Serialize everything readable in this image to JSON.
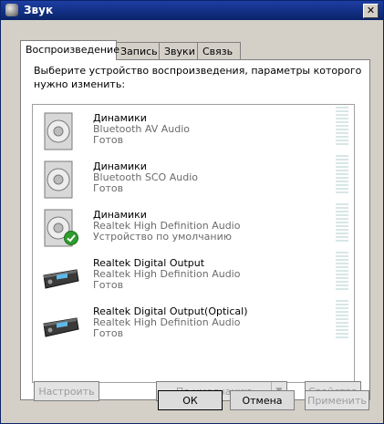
{
  "window": {
    "title": "Звук",
    "close_glyph": "✕"
  },
  "tabs": [
    {
      "label": "Воспроизведение",
      "active": true
    },
    {
      "label": "Запись",
      "active": false
    },
    {
      "label": "Звуки",
      "active": false
    },
    {
      "label": "Связь",
      "active": false
    }
  ],
  "instructions": "Выберите устройство воспроизведения, параметры которого нужно изменить:",
  "devices": [
    {
      "name": "Динамики",
      "desc": "Bluetooth AV Audio",
      "status": "Готов",
      "icon": "speaker-icon",
      "default": false
    },
    {
      "name": "Динамики",
      "desc": "Bluetooth SCO Audio",
      "status": "Готов",
      "icon": "speaker-icon",
      "default": false
    },
    {
      "name": "Динамики",
      "desc": "Realtek High Definition Audio",
      "status": "Устройство по умолчанию",
      "icon": "speaker-icon",
      "default": true
    },
    {
      "name": "Realtek Digital Output",
      "desc": "Realtek High Definition Audio",
      "status": "Готов",
      "icon": "receiver-icon",
      "default": false
    },
    {
      "name": "Realtek Digital Output(Optical)",
      "desc": "Realtek High Definition Audio",
      "status": "Готов",
      "icon": "receiver-icon",
      "default": false
    }
  ],
  "buttons": {
    "configure": "Настроить",
    "set_default": "По умолчанию",
    "properties": "Свойства",
    "ok": "ОК",
    "cancel": "Отмена",
    "apply": "Применить"
  },
  "colors": {
    "titlebar": "#0a246a",
    "disabled_text": "#9c9c9c",
    "default_check": "#2e9c2e"
  }
}
